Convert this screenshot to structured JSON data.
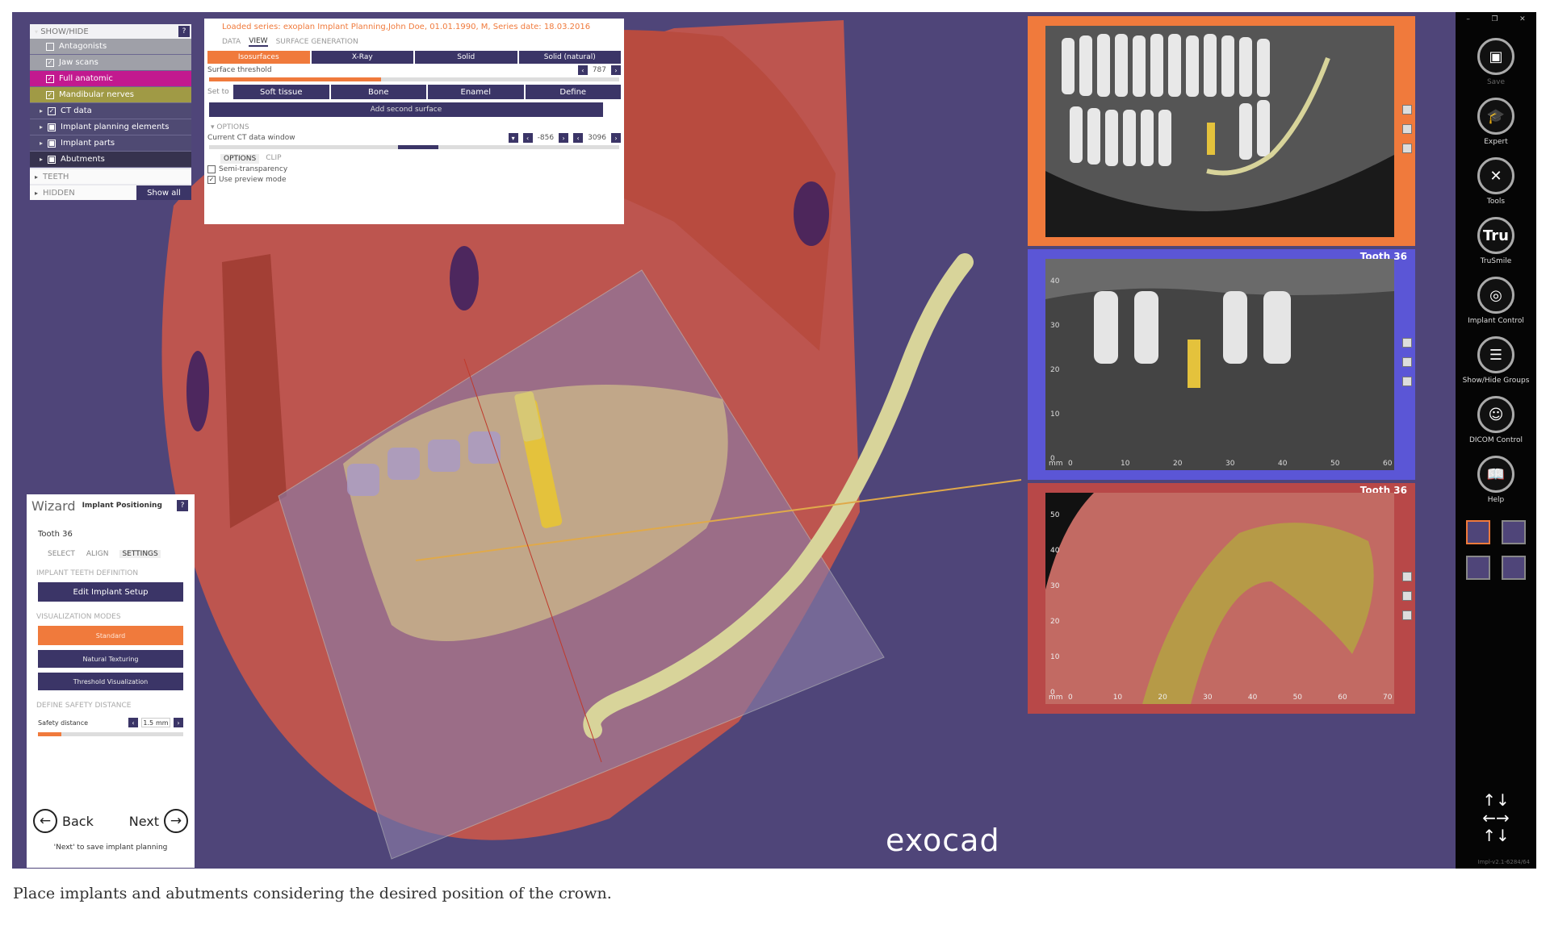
{
  "show_hide": {
    "title": "SHOW/HIDE",
    "help": "?",
    "items": [
      {
        "label": "Antagonists",
        "checked": false
      },
      {
        "label": "Jaw scans",
        "checked": true
      },
      {
        "label": "Full anatomic",
        "checked": true
      },
      {
        "label": "Mandibular nerves",
        "checked": true
      },
      {
        "label": "CT data",
        "checked": true
      },
      {
        "label": "Implant planning elements",
        "checked": true
      },
      {
        "label": "Implant parts",
        "checked": true
      },
      {
        "label": "Abutments",
        "checked": true
      }
    ],
    "teeth": "TEETH",
    "hidden": "HIDDEN",
    "show_all": "Show all"
  },
  "surface_panel": {
    "loaded": "Loaded series: exoplan Implant Planning,John Doe, 01.01.1990, M, Series date: 18.03.2016",
    "tabs": [
      "DATA",
      "VIEW",
      "SURFACE GENERATION"
    ],
    "modes": [
      "Isosurfaces",
      "X-Ray",
      "Solid",
      "Solid (natural)"
    ],
    "surface_threshold_label": "Surface threshold",
    "surface_threshold_value": "787",
    "surface_threshold_fraction": 0.42,
    "set_to_label": "Set to",
    "set_to": [
      "Soft tissue",
      "Bone",
      "Enamel",
      "Define"
    ],
    "add_second_surface": "Add second surface",
    "options_label": "OPTIONS",
    "ct_window_label": "Current CT data window",
    "ct_min": "-856",
    "ct_max": "3096",
    "subtabs": [
      "OPTIONS",
      "CLIP"
    ],
    "semi_transparency": "Semi-transparency",
    "use_preview": "Use preview mode"
  },
  "wizard": {
    "title": "Wizard",
    "subtitle": "Implant Positioning",
    "help": "?",
    "tooth": "Tooth 36",
    "tabs": [
      "SELECT",
      "ALIGN",
      "SETTINGS"
    ],
    "sec_teeth": "IMPLANT TEETH DEFINITION",
    "edit_setup": "Edit Implant Setup",
    "sec_vis": "VISUALIZATION MODES",
    "vis_modes": [
      "Standard",
      "Natural Texturing",
      "Threshold Visualization"
    ],
    "sec_safety": "DEFINE SAFETY DISTANCE",
    "safety_label": "Safety distance",
    "safety_value": "1.5",
    "safety_unit": "mm",
    "back": "Back",
    "next": "Next",
    "note": "'Next' to save implant planning"
  },
  "views": {
    "view2_label": "Tooth 36",
    "view3_label": "Tooth 36",
    "view2_y_ticks": [
      "40",
      "30",
      "20",
      "10",
      "0"
    ],
    "view2_x_ticks": [
      "0",
      "10",
      "20",
      "30",
      "40",
      "50",
      "60"
    ],
    "view3_y_ticks": [
      "50",
      "40",
      "30",
      "20",
      "10",
      "0"
    ],
    "view3_x_ticks": [
      "0",
      "10",
      "20",
      "30",
      "40",
      "50",
      "60",
      "70"
    ],
    "unit": "mm"
  },
  "toolbar": {
    "tools": [
      {
        "label": "Save",
        "icon": "save-icon",
        "glyph": "▣",
        "dim": true
      },
      {
        "label": "Expert",
        "icon": "graduation-cap-icon",
        "glyph": "🎓",
        "dim": false
      },
      {
        "label": "Tools",
        "icon": "tools-icon",
        "glyph": "✕",
        "dim": false
      },
      {
        "label": "TruSmile",
        "icon": "trusmile-icon",
        "glyph": "Tru",
        "dim": false
      },
      {
        "label": "Implant Control",
        "icon": "implant-control-icon",
        "glyph": "◎",
        "dim": false
      },
      {
        "label": "Show/Hide Groups",
        "icon": "show-hide-groups-icon",
        "glyph": "☰",
        "dim": false
      },
      {
        "label": "DICOM Control",
        "icon": "dicom-control-icon",
        "glyph": "☺",
        "dim": false
      },
      {
        "label": "Help",
        "icon": "help-book-icon",
        "glyph": "📖",
        "dim": false
      }
    ],
    "version": "Impl-v2.1-6284/64"
  },
  "brand": "exocad",
  "caption": "Place implants and abutments considering the desired position of the crown.",
  "colors": {
    "accent": "#f07a3c",
    "panel_dark": "#3b3567",
    "background": "#4f4579"
  }
}
